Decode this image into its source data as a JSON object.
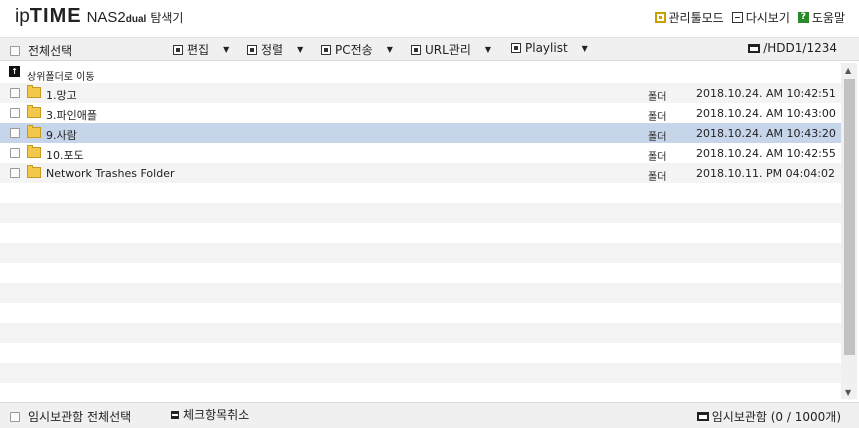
{
  "header": {
    "logo_ip": "ip",
    "logo_time": "TIME",
    "logo_nas": "NAS2",
    "logo_dual": "dual",
    "app_name": "탐색기",
    "links": [
      "관리툴모드",
      "다시보기",
      "도움말"
    ]
  },
  "toolbar": {
    "select_all": "전체선택",
    "buttons": [
      "편집",
      "정렬",
      "PC전송",
      "URL관리",
      "Playlist"
    ],
    "path": "/HDD1/1234"
  },
  "list": {
    "up_label": "상위폴더로 이동",
    "rows": [
      {
        "name": "1.망고",
        "type": "폴더",
        "date": "2018.10.24. AM 10:42:51"
      },
      {
        "name": "3.파인애플",
        "type": "폴더",
        "date": "2018.10.24. AM 10:43:00"
      },
      {
        "name": "9.사람",
        "type": "폴더",
        "date": "2018.10.24. AM 10:43:20"
      },
      {
        "name": "10.포도",
        "type": "폴더",
        "date": "2018.10.24. AM 10:42:55"
      },
      {
        "name": "Network Trashes Folder",
        "type": "폴더",
        "date": "2018.10.11. PM 04:04:02"
      }
    ]
  },
  "bottom": {
    "temp_select_all": "임시보관함 전체선택",
    "uncheck": "체크항목취소",
    "temp_box": "임시보관함 (0 / 1000개)"
  },
  "colors": {
    "selected_row": "#c7d5ea",
    "toolbar_bg": "#f0f0f0",
    "folder": "#f2c84b"
  }
}
